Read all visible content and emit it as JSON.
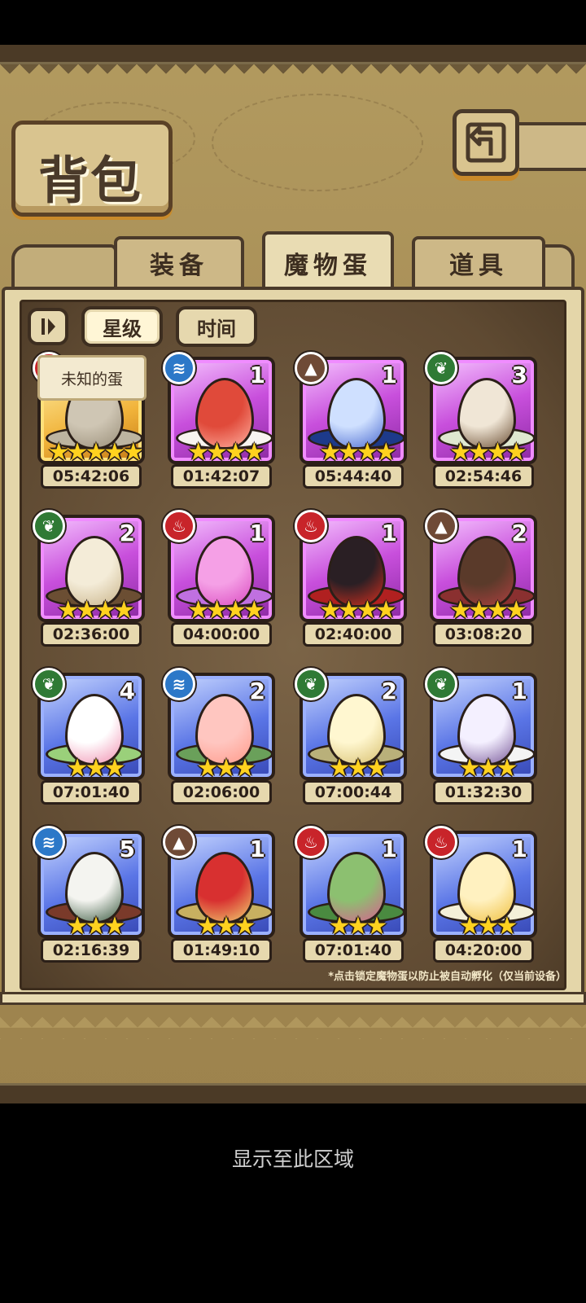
{
  "title": "背包",
  "tabs": [
    {
      "label": "装备"
    },
    {
      "label": "魔物蛋"
    },
    {
      "label": "道具"
    }
  ],
  "controls": {
    "sort_icon": "sort-toggle-icon",
    "star_label": "星级",
    "time_label": "时间"
  },
  "tooltip": "未知的蛋",
  "eggs": [
    {
      "element": "fire",
      "count": "",
      "stars": "★★★★★",
      "timer": "05:42:06",
      "rarity": "gold"
    },
    {
      "element": "water",
      "count": "1",
      "stars": "★★★★",
      "timer": "01:42:07",
      "rarity": "purple"
    },
    {
      "element": "earth",
      "count": "1",
      "stars": "★★★★",
      "timer": "05:44:40",
      "rarity": "purple"
    },
    {
      "element": "grass",
      "count": "3",
      "stars": "★★★★",
      "timer": "02:54:46",
      "rarity": "purple"
    },
    {
      "element": "grass",
      "count": "2",
      "stars": "★★★★",
      "timer": "02:36:00",
      "rarity": "purple"
    },
    {
      "element": "fire",
      "count": "1",
      "stars": "★★★★",
      "timer": "04:00:00",
      "rarity": "purple"
    },
    {
      "element": "fire",
      "count": "1",
      "stars": "★★★★",
      "timer": "02:40:00",
      "rarity": "purple"
    },
    {
      "element": "earth",
      "count": "2",
      "stars": "★★★★",
      "timer": "03:08:20",
      "rarity": "purple"
    },
    {
      "element": "grass",
      "count": "4",
      "stars": "★★★",
      "timer": "07:01:40",
      "rarity": "blue"
    },
    {
      "element": "water",
      "count": "2",
      "stars": "★★★",
      "timer": "02:06:00",
      "rarity": "blue"
    },
    {
      "element": "grass",
      "count": "2",
      "stars": "★★★",
      "timer": "07:00:44",
      "rarity": "blue"
    },
    {
      "element": "grass",
      "count": "1",
      "stars": "★★★",
      "timer": "01:32:30",
      "rarity": "blue"
    },
    {
      "element": "water",
      "count": "5",
      "stars": "★★★",
      "timer": "02:16:39",
      "rarity": "blue"
    },
    {
      "element": "earth",
      "count": "1",
      "stars": "★★★",
      "timer": "01:49:10",
      "rarity": "blue"
    },
    {
      "element": "fire",
      "count": "1",
      "stars": "★★★",
      "timer": "07:01:40",
      "rarity": "blue"
    },
    {
      "element": "fire",
      "count": "1",
      "stars": "★★★",
      "timer": "04:20:00",
      "rarity": "blue"
    }
  ],
  "note": "*点击锁定魔物蛋以防止被自动孵化（仅当前设备）",
  "footer": "显示至此区域",
  "colors": {
    "parchment": "#d9c48f",
    "frame_dark": "#4a3a2a",
    "star_gold": "#ffd21f",
    "rarity_purple": "#c84fdc",
    "rarity_blue": "#5a75e6",
    "rarity_gold": "#f1b33a"
  }
}
